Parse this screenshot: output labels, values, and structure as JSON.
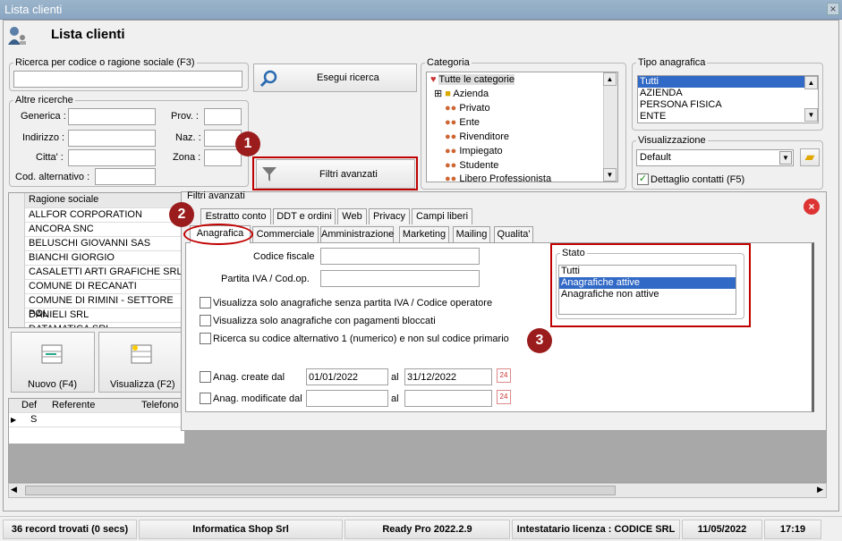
{
  "window": {
    "title": "Lista clienti",
    "close": "×"
  },
  "header": {
    "title": "Lista clienti"
  },
  "search": {
    "legend": "Ricerca per codice o ragione sociale (F3)",
    "value": "",
    "button": "Esegui ricerca"
  },
  "other": {
    "legend": "Altre ricerche",
    "generica": "Generica :",
    "indirizzo": "Indirizzo :",
    "citta": "Citta' :",
    "codalt": "Cod. alternativo :",
    "prov": "Prov. :",
    "naz": "Naz. :",
    "zona": "Zona :"
  },
  "filtri_button": "Filtri avanzati",
  "categoria": {
    "legend": "Categoria",
    "items": [
      "Tutte le categorie",
      "Azienda",
      "Privato",
      "Ente",
      "Rivenditore",
      "Impiegato",
      "Studente",
      "Libero Professionista"
    ]
  },
  "tipo": {
    "legend": "Tipo anagrafica",
    "items": [
      "Tutti",
      "AZIENDA",
      "PERSONA FISICA",
      "ENTE"
    ]
  },
  "visualizzazione": {
    "legend": "Visualizzazione",
    "value": "Default",
    "dettaglio": "Dettaglio contatti (F5)"
  },
  "clienti": {
    "header": "Ragione sociale",
    "rows": [
      "ALLFOR CORPORATION",
      "ANCORA SNC",
      "BELUSCHI GIOVANNI SAS",
      "BIANCHI GIORGIO",
      "CASALETTI ARTI GRAFICHE SRL",
      "COMUNE DI RECANATI",
      "COMUNE DI RIMINI - SETTORE POL",
      "DANIELI SRL",
      "DATAMATICA SRL"
    ]
  },
  "buttons": {
    "nuovo": "Nuovo (F4)",
    "visualizza": "Visualizza (F2)"
  },
  "contatti": {
    "cols": [
      "Def",
      "Referente",
      "Telefono"
    ],
    "row_def": "S"
  },
  "filtri": {
    "legend": "Filtri avanzati",
    "tabs_top": [
      "Estratto conto",
      "DDT e ordini",
      "Web",
      "Privacy",
      "Campi liberi"
    ],
    "tabs_bottom": [
      "Anagrafica",
      "Commerciale",
      "Amministrazione",
      "Marketing",
      "Mailing",
      "Qualita'"
    ],
    "codice_fiscale": "Codice fiscale",
    "partita_iva": "Partita IVA / Cod.op.",
    "chk1": "Visualizza solo anagrafiche senza partita IVA / Codice operatore",
    "chk2": "Visualizza solo anagrafiche con pagamenti bloccati",
    "chk3": "Ricerca su codice alternativo 1 (numerico)  e non sul codice primario",
    "create": "Anag. create dal",
    "modificate": "Anag. modificate dal",
    "al": "al",
    "date_from": "01/01/2022",
    "date_to": "31/12/2022",
    "cal": "24",
    "stato_legend": "Stato",
    "stato_items": [
      "Tutti",
      "Anagrafiche attive",
      "Anagrafiche non attive"
    ]
  },
  "callouts": [
    "1",
    "2",
    "3"
  ],
  "status": {
    "records": "36 record trovati (0 secs)",
    "company": "Informatica Shop Srl",
    "version": "Ready Pro 2022.2.9",
    "license": "Intestatario licenza : CODICE SRL",
    "date": "11/05/2022",
    "time": "17:19"
  }
}
